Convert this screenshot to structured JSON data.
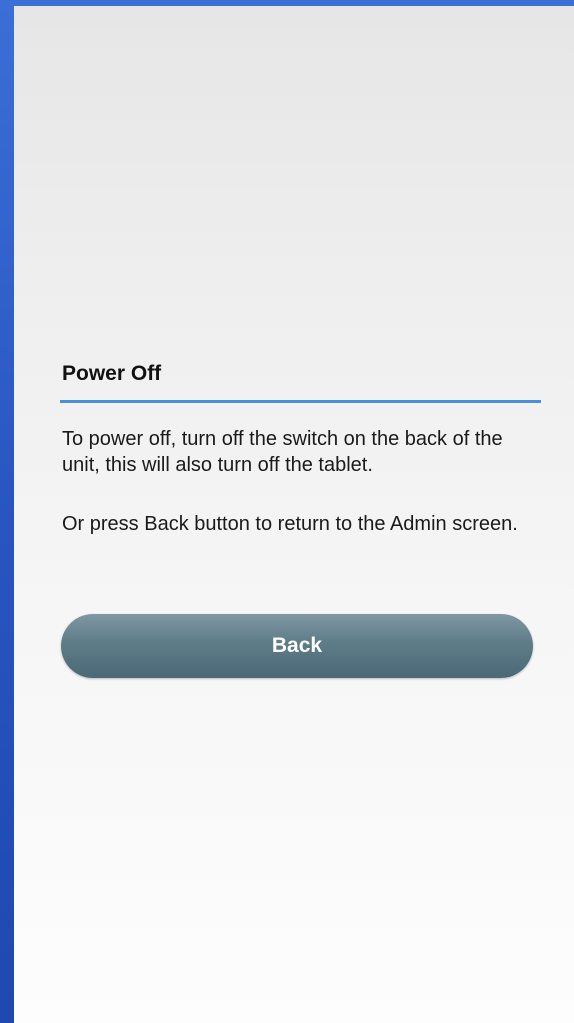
{
  "dialog": {
    "title": "Power Off",
    "message_line_1": "To power off, turn off the switch on the back of the unit, this will also turn off the tablet.",
    "message_line_2": "Or press Back button to return to the Admin screen.",
    "back_button_label": "Back"
  },
  "colors": {
    "accent_divider": "#4a90d9",
    "button": "#5f7c89",
    "frame": "#2f5fc4"
  }
}
